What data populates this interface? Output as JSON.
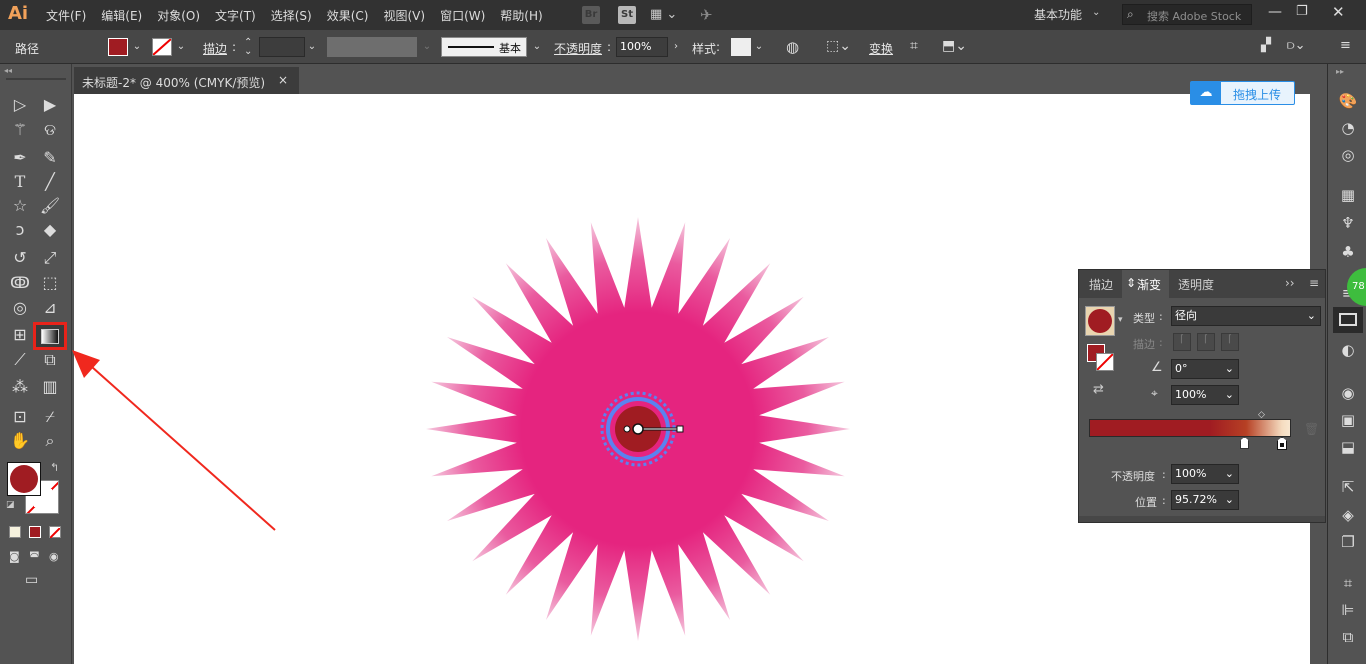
{
  "app": {
    "logo": "Ai"
  },
  "menu": [
    "文件(F)",
    "编辑(E)",
    "对象(O)",
    "文字(T)",
    "选择(S)",
    "效果(C)",
    "视图(V)",
    "窗口(W)",
    "帮助(H)"
  ],
  "badges": {
    "br": "Br",
    "st": "St"
  },
  "workspace": "基本功能",
  "search": {
    "placeholder": "搜索 Adobe Stock"
  },
  "control": {
    "selection_label": "路径",
    "stroke_label": "描边",
    "stroke_style": "基本",
    "opacity_label": "不透明度",
    "opacity_value": "100%",
    "style_label": "样式",
    "transform_label": "变换"
  },
  "document": {
    "tab_title": "未标题-2* @ 400% (CMYK/预览)",
    "close_glyph": "×"
  },
  "upload": {
    "label": "拖拽上传"
  },
  "status_circle": "78",
  "gradient_panel": {
    "tabs": [
      "描边",
      "渐变",
      "透明度"
    ],
    "active_tab": "渐变",
    "type_label": "类型",
    "type_value": "径向",
    "stroke_label": "描边",
    "angle_value": "0°",
    "aspect_value": "100%",
    "opacity_label": "不透明度",
    "opacity_value": "100%",
    "position_label": "位置",
    "position_value": "95.72%"
  },
  "colors": {
    "fill": "#a01c22",
    "star": "#e5247f",
    "star_tip": "#f1bcd6",
    "ui_dark": "#323232",
    "ui_mid": "#535353",
    "accent_blue": "#5b82f0",
    "annotation": "#f0281e"
  }
}
